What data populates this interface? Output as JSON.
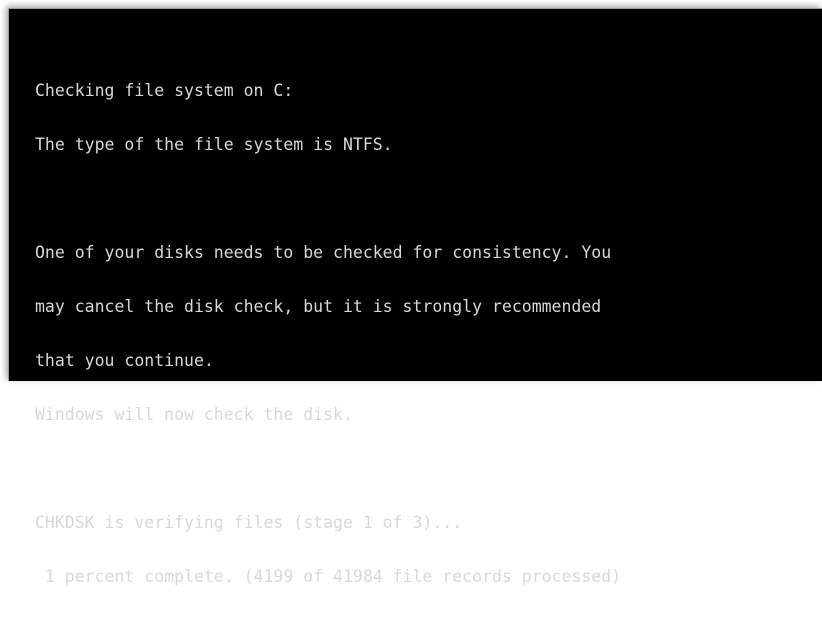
{
  "console": {
    "lines": [
      "Checking file system on C:",
      "The type of the file system is NTFS.",
      "",
      "One of your disks needs to be checked for consistency. You",
      "may cancel the disk check, but it is strongly recommended",
      "that you continue.",
      "Windows will now check the disk.",
      "",
      "CHKDSK is verifying files (stage 1 of 3)...",
      " 1 percent complete. (4199 of 41984 file records processed)"
    ]
  },
  "colors": {
    "background": "#000000",
    "text": "#d8d8d8"
  }
}
